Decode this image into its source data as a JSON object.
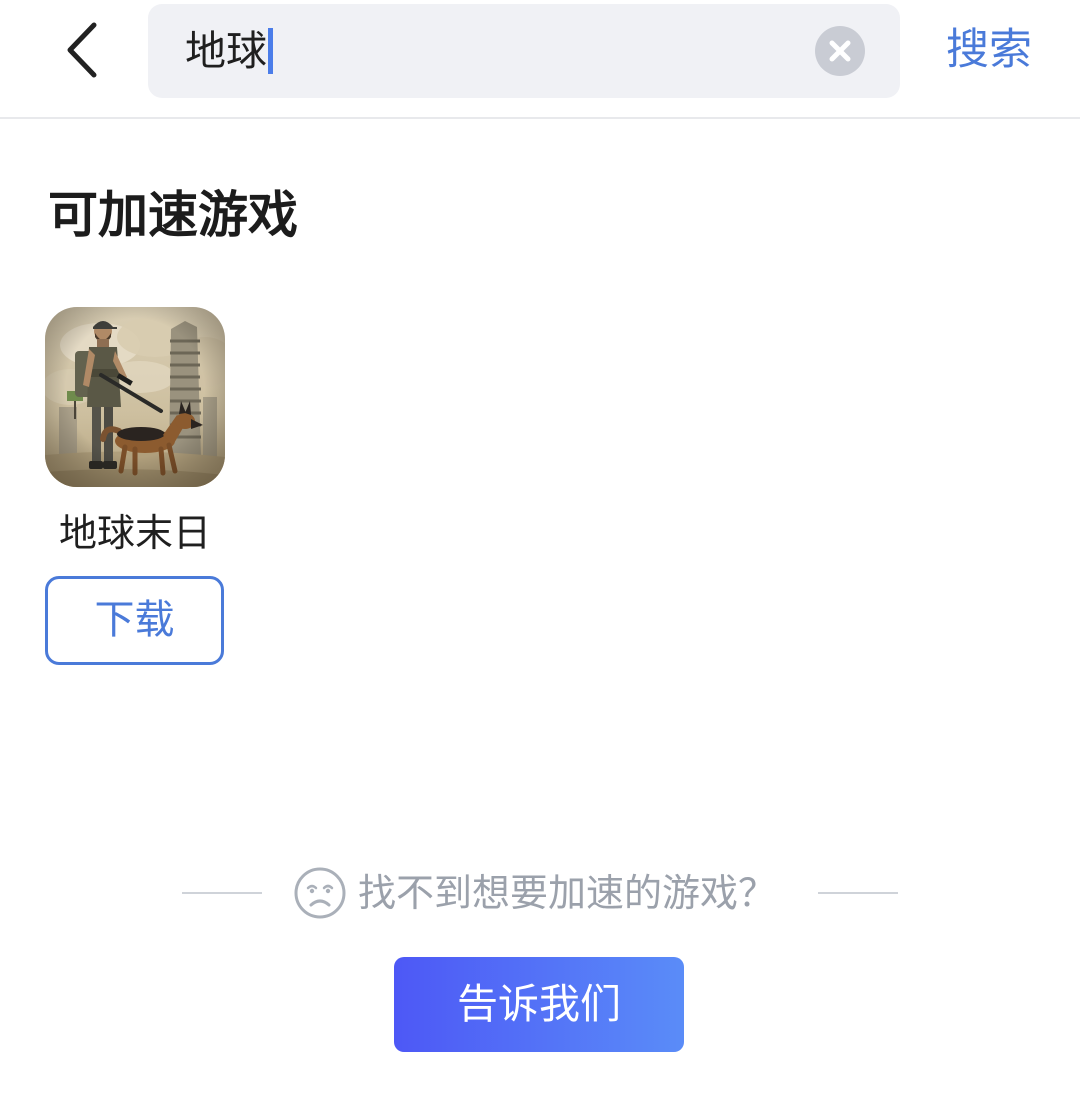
{
  "header": {
    "back_icon": "chevron-left-icon",
    "search_value": "地球",
    "clear_icon": "clear-circle-icon",
    "search_button_label": "搜索"
  },
  "section": {
    "title": "可加速游戏",
    "games": [
      {
        "name": "地球末日",
        "cover": "game-cover-survivor-with-dog",
        "download_label": "下载"
      }
    ]
  },
  "feedback": {
    "icon": "sad-face-icon",
    "prompt": "找不到想要加速的游戏？",
    "button_label": "告诉我们"
  },
  "colors": {
    "accent": "#4a7ad9",
    "caret": "#4b7de9",
    "muted_text": "#9ba1ab",
    "field_background": "#f0f1f5",
    "button_gradient_start": "#4d58f6",
    "button_gradient_end": "#5a8cf8"
  }
}
